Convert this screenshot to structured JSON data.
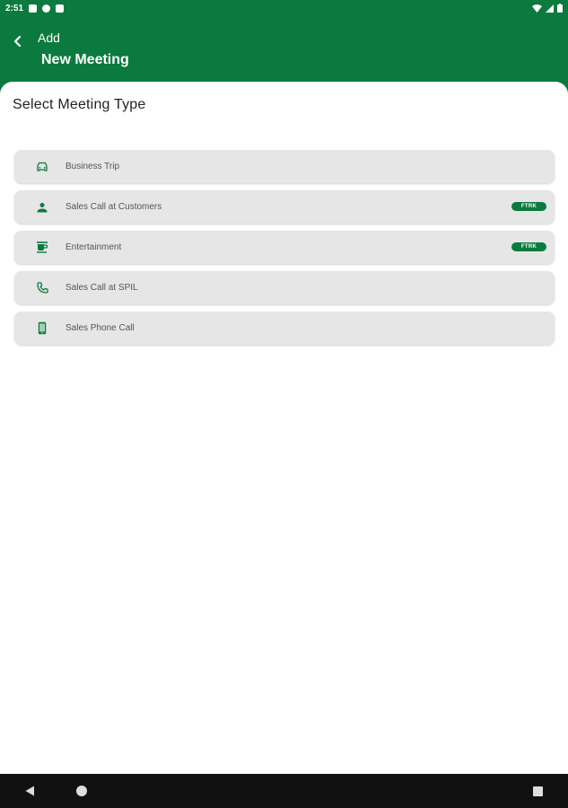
{
  "status_bar": {
    "time": "2:51",
    "icons": [
      "notification-icon",
      "profile-icon",
      "clipboard-icon"
    ],
    "right_icons": [
      "wifi-icon",
      "signal-icon",
      "battery-icon"
    ]
  },
  "app_bar": {
    "supertitle": "Add",
    "title": "New Meeting",
    "back_icon": "chevron-left-icon"
  },
  "section_title": "Select Meeting Type",
  "meeting_types": [
    {
      "label": "Business Trip",
      "icon": "car-icon",
      "badge": ""
    },
    {
      "label": "Sales Call at Customers",
      "icon": "person-icon",
      "badge": "FTRK"
    },
    {
      "label": "Entertainment",
      "icon": "cup-icon",
      "badge": "FTRK"
    },
    {
      "label": "Sales Call at SPIL",
      "icon": "phone-icon",
      "badge": ""
    },
    {
      "label": "Sales Phone Call",
      "icon": "mobile-icon",
      "badge": ""
    }
  ],
  "colors": {
    "primary": "#0b7a3e",
    "item_bg": "#e6e6e6",
    "text": "#555555"
  }
}
